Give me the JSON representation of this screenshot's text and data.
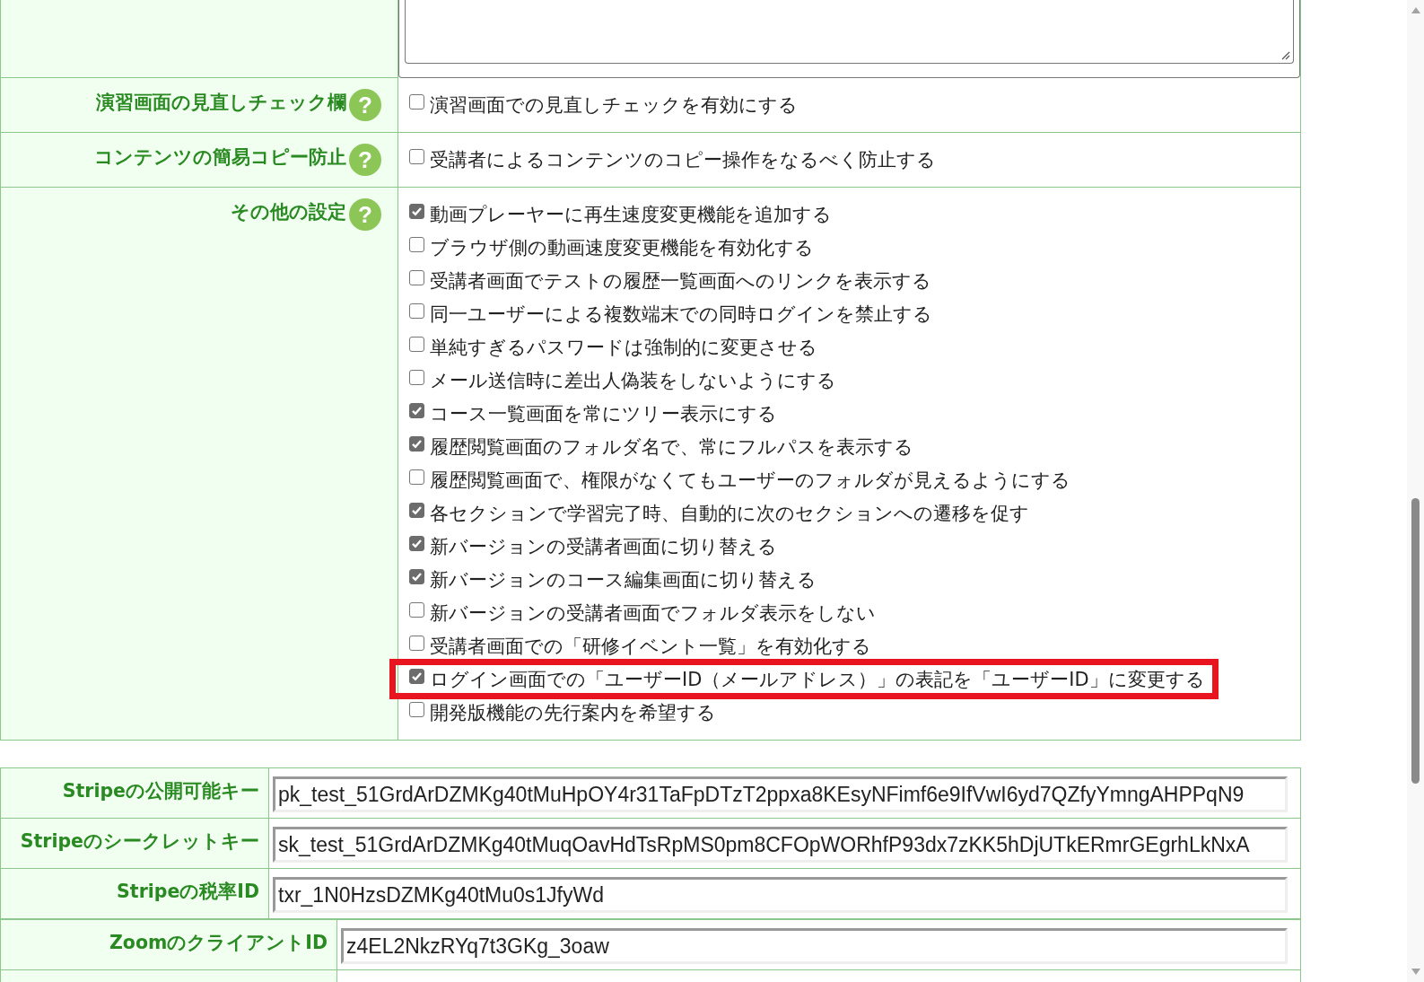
{
  "settings": [
    {
      "kind": "textarea"
    },
    {
      "kind": "checks",
      "label": "演習画面の見直しチェック欄",
      "help": "?",
      "options": [
        {
          "text": "演習画面での見直しチェックを有効にする",
          "checked": false,
          "highlighted": false
        }
      ]
    },
    {
      "kind": "checks",
      "label": "コンテンツの簡易コピー防止",
      "help": "?",
      "options": [
        {
          "text": "受講者によるコンテンツのコピー操作をなるべく防止する",
          "checked": false,
          "highlighted": false
        }
      ]
    },
    {
      "kind": "checks",
      "label": "その他の設定",
      "help": "?",
      "options": [
        {
          "text": "動画プレーヤーに再生速度変更機能を追加する",
          "checked": true,
          "highlighted": false
        },
        {
          "text": "ブラウザ側の動画速度変更機能を有効化する",
          "checked": false,
          "highlighted": false
        },
        {
          "text": "受講者画面でテストの履歴一覧画面へのリンクを表示する",
          "checked": false,
          "highlighted": false
        },
        {
          "text": "同一ユーザーによる複数端末での同時ログインを禁止する",
          "checked": false,
          "highlighted": false
        },
        {
          "text": "単純すぎるパスワードは強制的に変更させる",
          "checked": false,
          "highlighted": false
        },
        {
          "text": "メール送信時に差出人偽装をしないようにする",
          "checked": false,
          "highlighted": false
        },
        {
          "text": "コース一覧画面を常にツリー表示にする",
          "checked": true,
          "highlighted": false
        },
        {
          "text": "履歴閲覧画面のフォルダ名で、常にフルパスを表示する",
          "checked": true,
          "highlighted": false
        },
        {
          "text": "履歴閲覧画面で、権限がなくてもユーザーのフォルダが見えるようにする",
          "checked": false,
          "highlighted": false
        },
        {
          "text": "各セクションで学習完了時、自動的に次のセクションへの遷移を促す",
          "checked": true,
          "highlighted": false
        },
        {
          "text": "新バージョンの受講者画面に切り替える",
          "checked": true,
          "highlighted": false
        },
        {
          "text": "新バージョンのコース編集画面に切り替える",
          "checked": true,
          "highlighted": false
        },
        {
          "text": "新バージョンの受講者画面でフォルダ表示をしない",
          "checked": false,
          "highlighted": false
        },
        {
          "text": "受講者画面での「研修イベント一覧」を有効化する",
          "checked": false,
          "highlighted": false
        },
        {
          "text": "ログイン画面での「ユーザーID（メールアドレス）」の表記を「ユーザーID」に変更する",
          "checked": true,
          "highlighted": true
        },
        {
          "text": "開発版機能の先行案内を希望する",
          "checked": false,
          "highlighted": false
        }
      ]
    }
  ],
  "key_tables": [
    {
      "rows": [
        {
          "label": "Stripeの公開可能キー",
          "value": "pk_test_51GrdArDZMKg40tMuHpOY4r31TaFpDTzT2ppxa8KEsyNFimf6e9IfVwI6yd7QZfyYmngAHPPqN9"
        },
        {
          "label": "Stripeのシークレットキー",
          "value": "sk_test_51GrdArDZMKg40tMuqOavHdTsRpMS0pm8CFOpWORhfP93dx7zKK5hDjUTkERmrGEgrhLkNxA"
        },
        {
          "label": "Stripeの税率ID",
          "value": "txr_1N0HzsDZMKg40tMu0s1JfyWd"
        }
      ]
    },
    {
      "rows": [
        {
          "label": "ZoomのクライアントID",
          "value": "z4EL2NkzRYq7t3GKg_3oaw"
        }
      ]
    }
  ]
}
